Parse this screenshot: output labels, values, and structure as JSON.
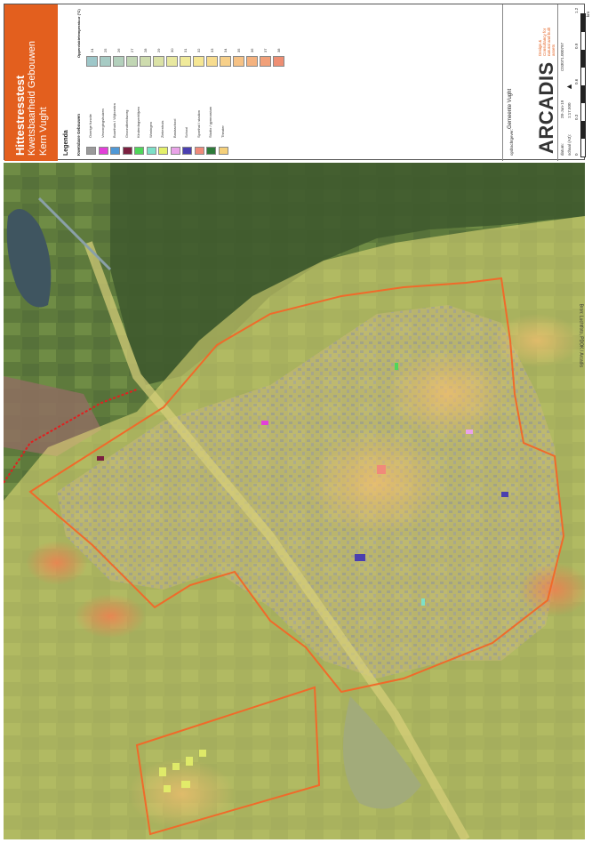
{
  "title": {
    "main": "Hittestresstest",
    "subtitle": "Kwetsbaarheid Gebouwen",
    "place": "Kern Vught"
  },
  "legend": {
    "title": "Legenda",
    "buildings_header": "Kwetsbare Gebouwen",
    "temperature_header": "Oppervlaktetemperatuur (°C)",
    "buildings": [
      {
        "label": "Overige functie",
        "color": "#9a9a9a"
      },
      {
        "label": "Verzorgingshuizen",
        "color": "#e23fd8"
      },
      {
        "label": "Buurthuis / Wijkcentra",
        "color": "#4f98d6"
      },
      {
        "label": "Gezondheidszorg",
        "color": "#7b2040"
      },
      {
        "label": "Kinderdagverblijven",
        "color": "#4fd65a"
      },
      {
        "label": "Woningen",
        "color": "#7de0c8"
      },
      {
        "label": "Ziekenhuis",
        "color": "#e4f06a"
      },
      {
        "label": "Basisschool",
        "color": "#e9a3e8"
      },
      {
        "label": "School",
        "color": "#4a3fb0"
      },
      {
        "label": "Sporthal / stadion",
        "color": "#f08a7a"
      },
      {
        "label": "Studio / gymnasium",
        "color": "#2d7a3a"
      },
      {
        "label": "Theater",
        "color": "#f5d07a"
      }
    ],
    "temperatures": [
      {
        "value": "24",
        "color": "#9ec7c9"
      },
      {
        "value": "25",
        "color": "#a7cbc4"
      },
      {
        "value": "26",
        "color": "#b3d0bc"
      },
      {
        "value": "27",
        "color": "#c1d6b4"
      },
      {
        "value": "28",
        "color": "#cedcae"
      },
      {
        "value": "29",
        "color": "#dbe2a6"
      },
      {
        "value": "30",
        "color": "#e8e8a0"
      },
      {
        "value": "31",
        "color": "#f0ea9a"
      },
      {
        "value": "32",
        "color": "#f6e794"
      },
      {
        "value": "33",
        "color": "#f7dc8f"
      },
      {
        "value": "34",
        "color": "#f7d08a"
      },
      {
        "value": "35",
        "color": "#f6c285"
      },
      {
        "value": "36",
        "color": "#f4b27f"
      },
      {
        "value": "37",
        "color": "#f1a079"
      },
      {
        "value": "38",
        "color": "#ee8e73"
      }
    ]
  },
  "meta": {
    "client_label": "opdrachtgever:",
    "client": "Gemeente Vught",
    "date_label": "datum:",
    "date": "28-Jun-19",
    "scale_label": "schaal (A3):",
    "scale": "1:17.500",
    "project": "C03071.000797",
    "scale_ticks": [
      "0",
      "0.3",
      "0.6",
      "0.9",
      "1.2"
    ],
    "scale_unit": "km"
  },
  "company": {
    "name": "ARCADIS",
    "tagline": "Design & Consultancy for natural and built assets"
  },
  "credit": "Bron: Luchtfoto, PDOK / Arcadis"
}
